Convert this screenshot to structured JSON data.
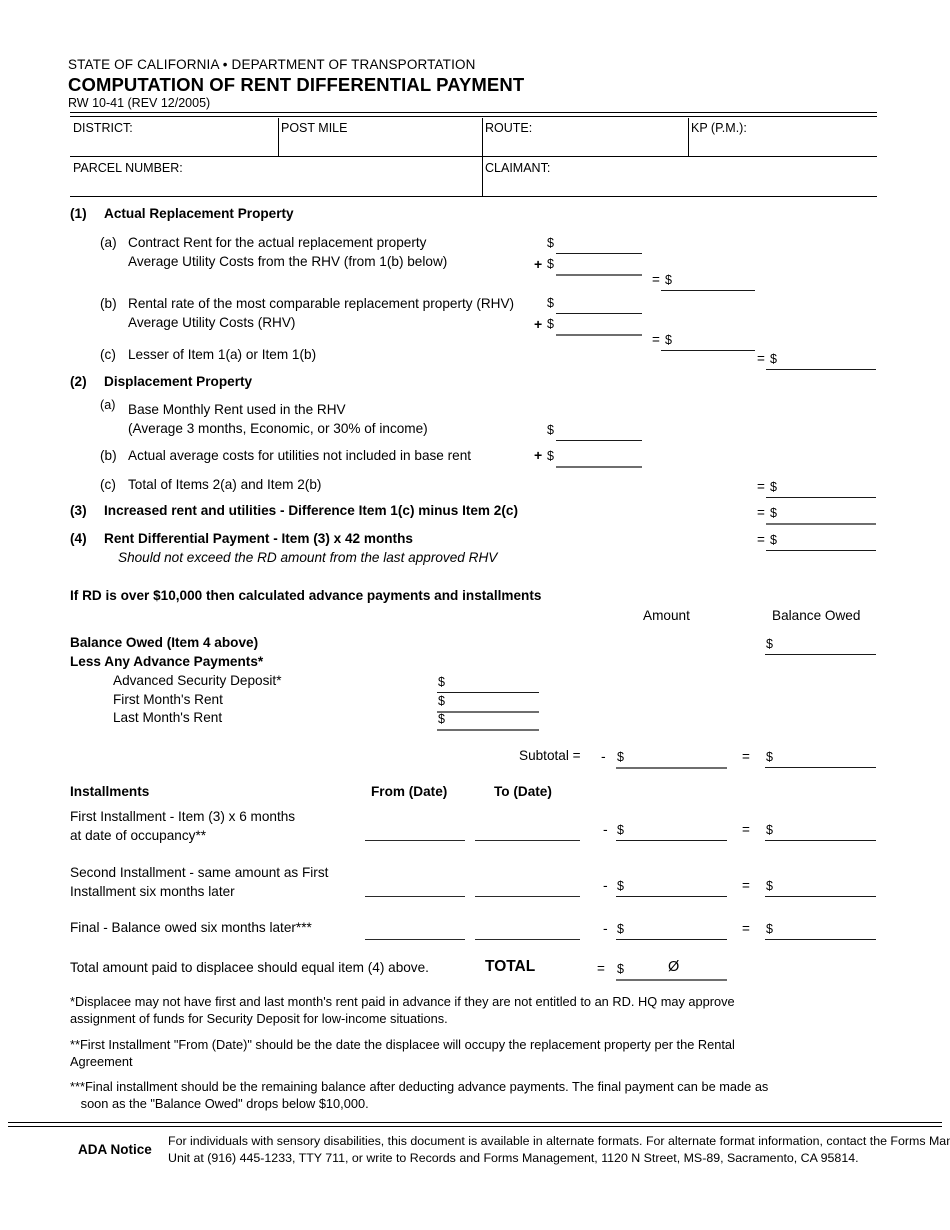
{
  "header": {
    "agency": "STATE OF CALIFORNIA • DEPARTMENT OF TRANSPORTATION",
    "title": "COMPUTATION OF RENT DIFFERENTIAL PAYMENT",
    "form_number": "RW 10-41  (REV 12/2005)"
  },
  "info_table": {
    "district_label": "DISTRICT:",
    "district_value": "",
    "post_mile_label": "POST MILE",
    "post_mile_value": "",
    "route_label": "ROUTE:",
    "route_value": "",
    "kp_label": "KP (P.M.):",
    "kp_value": "",
    "parcel_label": "PARCEL NUMBER:",
    "parcel_value": "",
    "claimant_label": "CLAIMANT:",
    "claimant_value": ""
  },
  "section1": {
    "number": "(1)",
    "title": "Actual Replacement Property",
    "a_label": "(a)",
    "a_line1": "Contract Rent for the actual replacement property",
    "a_line2": "Average Utility Costs from the RHV (from 1(b) below)",
    "b_label": "(b)",
    "b_line1": "Rental rate of the most comparable replacement property (RHV)",
    "b_line2": "Average Utility Costs (RHV)",
    "c_label": "(c)",
    "c_line1": "Lesser of Item 1(a) or Item 1(b)",
    "values": {
      "a_rent": "",
      "a_utilities": "",
      "a_total": "",
      "b_rent": "",
      "b_utilities": "",
      "b_total": "",
      "c_total": ""
    }
  },
  "section2": {
    "number": "(2)",
    "title": "Displacement Property",
    "a_label": "(a)",
    "a_line1": "Base Monthly Rent used in the RHV",
    "a_line2": "(Average 3 months, Economic, or 30% of income)",
    "b_label": "(b)",
    "b_line1": "Actual average costs for utilities not included in base rent",
    "c_label": "(c)",
    "c_line1": "Total of Items 2(a) and Item 2(b)",
    "values": {
      "a_rent": "",
      "b_utilities": "",
      "c_total": ""
    }
  },
  "section3": {
    "number": "(3)",
    "title": "Increased rent and utilities - Difference Item 1(c) minus Item 2(c)",
    "value": ""
  },
  "section4": {
    "number": "(4)",
    "title": "Rent Differential Payment - Item (3) x 42 months",
    "note": "Should not exceed the RD amount from the last approved RHV",
    "value": ""
  },
  "advance": {
    "heading": "If RD is over $10,000 then calculated advance payments and installments",
    "col_amount": "Amount",
    "col_balance_owed": "Balance Owed",
    "balance_owed_label": "Balance Owed (Item 4 above)",
    "balance_owed_value": "",
    "less_label": "Less Any Advance Payments*",
    "rows": [
      {
        "label": "Advanced Security Deposit*",
        "amount": ""
      },
      {
        "label": "First Month's Rent",
        "amount": ""
      },
      {
        "label": "Last Month's Rent",
        "amount": ""
      }
    ],
    "subtotal_label": "Subtotal =",
    "subtotal_minus": "-",
    "subtotal_amount": "",
    "subtotal_eq": "=",
    "subtotal_balance": ""
  },
  "installments": {
    "heading": "Installments",
    "col_from": "From (Date)",
    "col_to": "To (Date)",
    "rows": [
      {
        "line1": "First Installment - Item (3) x 6 months",
        "line2": "at date of occupancy**",
        "from": "",
        "to": "",
        "amount": "",
        "balance": ""
      },
      {
        "line1": "Second Installment - same amount as First",
        "line2": "Installment six months later",
        "from": "",
        "to": "",
        "amount": "",
        "balance": ""
      },
      {
        "line1": "Final - Balance owed six months later***",
        "line2": "",
        "from": "",
        "to": "",
        "amount": "",
        "balance": ""
      }
    ],
    "total_note": "Total amount paid to displacee should equal item (4) above.",
    "total_label": "TOTAL",
    "total_eq": "=",
    "total_value": "Ø"
  },
  "footnotes": {
    "one_line1": "*Displacee may not have first and last month's rent paid in advance if they are not entitled to an RD.  HQ may approve",
    "one_line2": "assignment of funds for Security Deposit for low-income situations.",
    "two_line1": "**First Installment \"From (Date)\" should be the date the displacee will occupy the replacement property per the Rental",
    "two_line2": " Agreement",
    "three_line1": "***Final installment should be the remaining balance after deducting advance payments.  The final payment can be made as",
    "three_line2": "   soon as the \"Balance Owed\" drops below $10,000."
  },
  "ada": {
    "label": "ADA Notice",
    "line1": "For individuals with sensory disabilities, this document is available in alternate formats. For alternate format information, contact the Forms Management",
    "line2": "Unit at (916) 445-1233, TTY 711, or write to Records and Forms Management, 1120 N Street, MS-89, Sacramento, CA 95814."
  },
  "symbols": {
    "dollar": "$",
    "plus": "+",
    "equals": "=",
    "minus": "-"
  }
}
